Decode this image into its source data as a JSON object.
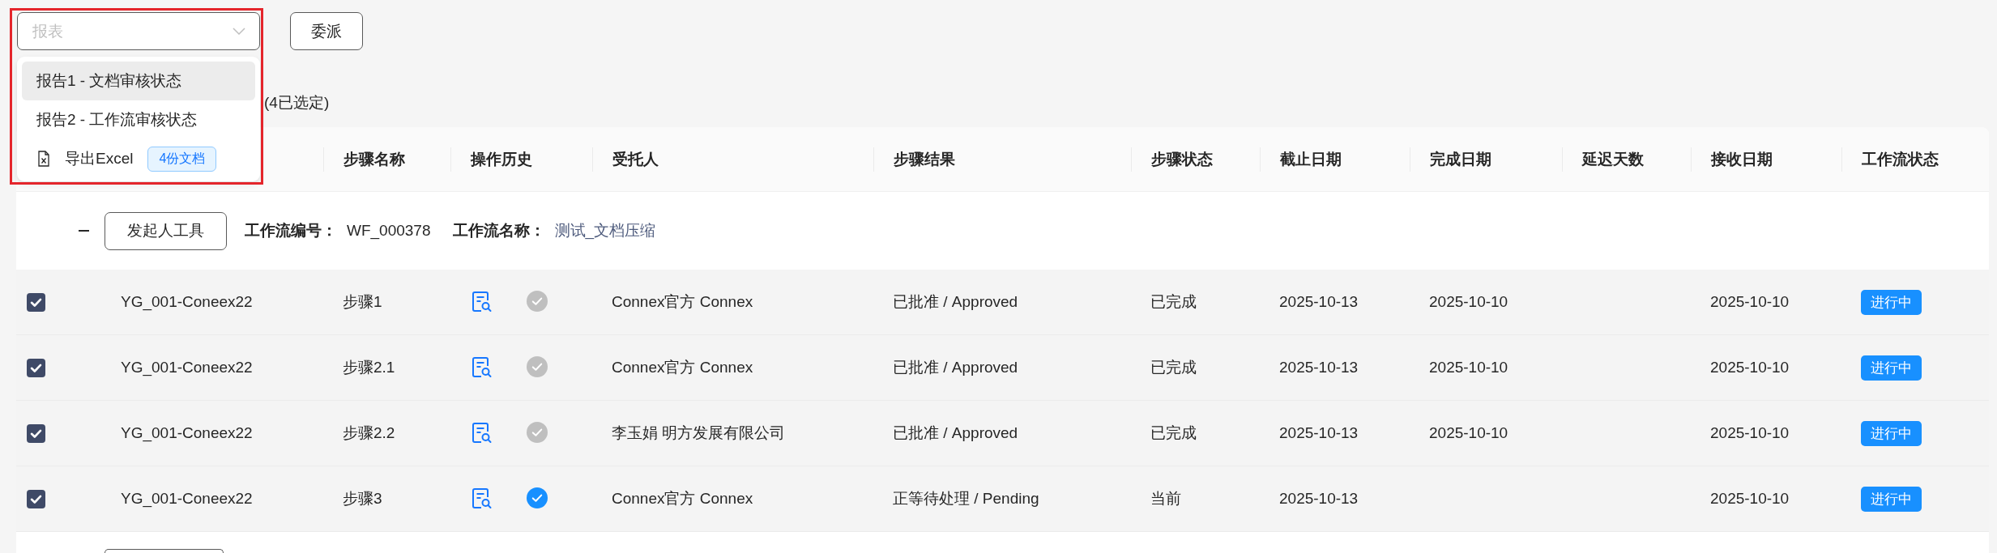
{
  "toolbar": {
    "report_select": {
      "placeholder": "报表",
      "open": true,
      "highlighted": true
    },
    "delegate_button": "委派"
  },
  "report_menu": {
    "items": [
      {
        "kind": "report",
        "label": "报告1 - 文档审核状态",
        "selected": true
      },
      {
        "kind": "report",
        "label": "报告2 - 工作流审核状态",
        "selected": false
      },
      {
        "kind": "export",
        "label": "导出Excel",
        "badge": "4份文档",
        "selected": false
      }
    ]
  },
  "selection_note": "(4已选定)",
  "table": {
    "columns": [
      "步骤名称",
      "操作历史",
      "受托人",
      "步骤结果",
      "步骤状态",
      "截止日期",
      "完成日期",
      "延迟天数",
      "接收日期",
      "工作流状态"
    ],
    "groups": [
      {
        "expanded": true,
        "initiator_button": "发起人工具",
        "workflow_no_label": "工作流编号：",
        "workflow_no": "WF_000378",
        "workflow_name_label": "工作流名称：",
        "workflow_name": "测试_文档压缩",
        "rows": [
          {
            "checked": true,
            "document": "YG_001-Coneex22",
            "step": "步骤1",
            "history_current": false,
            "assignee": "Connex官方 Connex",
            "result": "已批准 / Approved",
            "step_status": "已完成",
            "due_date": "2025-10-13",
            "completed_date": "2025-10-10",
            "received_date": "2025-10-10",
            "workflow_status": "进行中"
          },
          {
            "checked": true,
            "document": "YG_001-Coneex22",
            "step": "步骤2.1",
            "history_current": false,
            "assignee": "Connex官方 Connex",
            "result": "已批准 / Approved",
            "step_status": "已完成",
            "due_date": "2025-10-13",
            "completed_date": "2025-10-10",
            "received_date": "2025-10-10",
            "workflow_status": "进行中"
          },
          {
            "checked": true,
            "document": "YG_001-Coneex22",
            "step": "步骤2.2",
            "history_current": false,
            "assignee": "李玉娟 明方发展有限公司",
            "result": "已批准 / Approved",
            "step_status": "已完成",
            "due_date": "2025-10-13",
            "completed_date": "2025-10-10",
            "received_date": "2025-10-10",
            "workflow_status": "进行中"
          },
          {
            "checked": true,
            "document": "YG_001-Coneex22",
            "step": "步骤3",
            "history_current": true,
            "assignee": "Connex官方 Connex",
            "result": "正等待处理 / Pending",
            "step_status": "当前",
            "due_date": "2025-10-13",
            "received_date": "2025-10-10",
            "workflow_status": "进行中"
          }
        ]
      }
    ],
    "next_group_partly_visible": true
  }
}
